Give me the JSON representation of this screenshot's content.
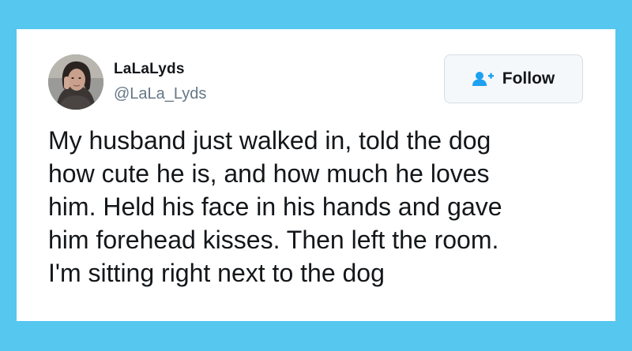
{
  "user": {
    "display_name": "LaLaLyds",
    "handle": "@LaLa_Lyds",
    "avatar_icon": "profile-photo"
  },
  "follow_button": {
    "label": "Follow",
    "icon": "add-user-icon",
    "icon_color": "#1da1f2"
  },
  "tweet": {
    "lines": [
      "My husband just walked in, told the dog",
      "how cute he is, and how much he loves",
      "him. Held his face in his hands and gave",
      "him forehead kisses. Then left the room.",
      "I'm sitting right next to the dog"
    ]
  },
  "colors": {
    "background": "#56c7ee",
    "card": "#ffffff",
    "text": "#14171a",
    "secondary_text": "#657786"
  }
}
